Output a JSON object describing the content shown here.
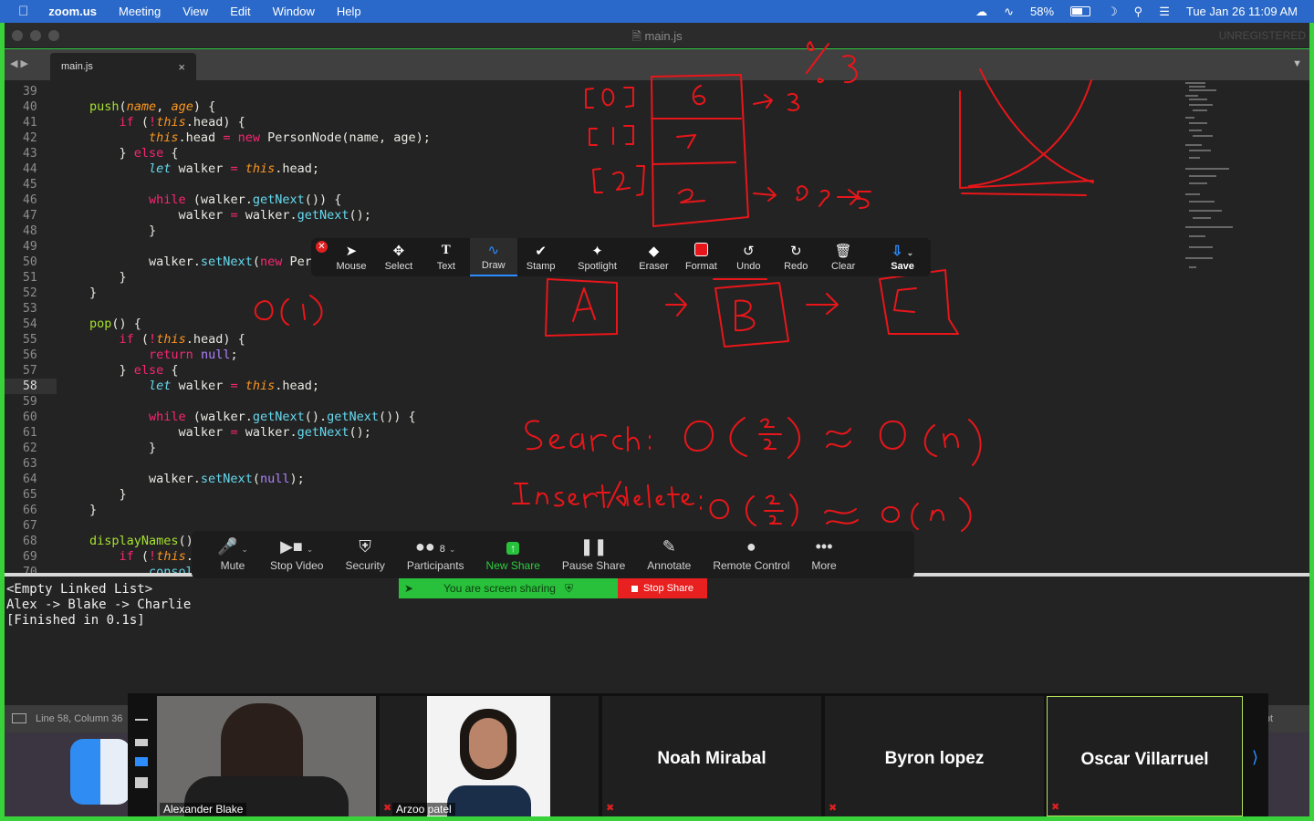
{
  "menubar": {
    "app": "zoom.us",
    "items": [
      "Meeting",
      "View",
      "Edit",
      "Window",
      "Help"
    ],
    "battery": "58%",
    "datetime": "Tue Jan 26  11:09 AM"
  },
  "window": {
    "title": "main.js",
    "unregistered": "UNREGISTERED"
  },
  "tab": {
    "label": "main.js",
    "close": "×"
  },
  "editor": {
    "current_line": 58,
    "line_numbers": [
      39,
      40,
      41,
      42,
      43,
      44,
      45,
      46,
      47,
      48,
      49,
      50,
      51,
      52,
      53,
      54,
      55,
      56,
      57,
      58,
      59,
      60,
      61,
      62,
      63,
      64,
      65,
      66,
      67,
      68,
      69,
      70
    ]
  },
  "annotate_toolbar": {
    "tools": [
      "Mouse",
      "Select",
      "Text",
      "Draw",
      "Stamp",
      "Spotlight",
      "Eraser",
      "Format",
      "Undo",
      "Redo",
      "Clear",
      "Save"
    ],
    "active": "Draw"
  },
  "zoom_controls": {
    "mute": "Mute",
    "stop_video": "Stop Video",
    "security": "Security",
    "participants": "Participants",
    "participant_count": "8",
    "new_share": "New Share",
    "pause_share": "Pause Share",
    "annotate": "Annotate",
    "remote_control": "Remote Control",
    "more": "More"
  },
  "share_status": {
    "sharing": "You are screen sharing",
    "stop": "Stop Share"
  },
  "console": {
    "lines": [
      "<Empty Linked List>",
      "Alex -> Blake -> Charlie",
      "[Finished in 0.1s]"
    ]
  },
  "statusbar": {
    "left": "Line 58, Column 36",
    "right": "ript"
  },
  "gallery": {
    "participants": [
      {
        "name": "Alexander Blake",
        "video": true
      },
      {
        "name": "Arzoo patel",
        "video": true
      },
      {
        "name": "Noah Mirabal",
        "video": false
      },
      {
        "name": "Byron lopez",
        "video": false
      },
      {
        "name": "Oscar Villarruel",
        "video": false
      }
    ]
  },
  "colors": {
    "accent": "#2d8cff",
    "share_green": "#29c13b",
    "stop_red": "#e82020",
    "ink": "#e8161a"
  }
}
